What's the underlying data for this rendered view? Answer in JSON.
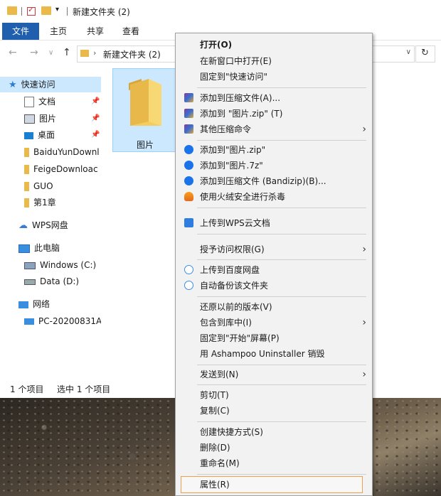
{
  "window": {
    "title": "新建文件夹 (2)"
  },
  "ribbon": {
    "tabs": [
      "文件",
      "主页",
      "共享",
      "查看"
    ]
  },
  "address": {
    "path": "新建文件夹 (2)"
  },
  "nav": {
    "quick_access": "快速访问",
    "items": [
      {
        "label": "文档",
        "pinned": true
      },
      {
        "label": "图片",
        "pinned": true
      },
      {
        "label": "桌面",
        "pinned": true
      },
      {
        "label": "BaiduYunDownl"
      },
      {
        "label": "FeigeDownloac"
      },
      {
        "label": "GUO"
      },
      {
        "label": "第1章"
      }
    ],
    "wps": "WPS网盘",
    "this_pc": "此电脑",
    "drives": [
      "Windows (C:)",
      "Data (D:)"
    ],
    "network": "网络",
    "network_pc": "PC-20200831AI"
  },
  "content": {
    "folder_name": "图片"
  },
  "status": {
    "count": "1 个项目",
    "selected": "选中 1 个项目"
  },
  "menu": {
    "items": [
      {
        "label": "打开(O)",
        "bold": true
      },
      {
        "label": "在新窗口中打开(E)"
      },
      {
        "label": "固定到\"快速访问\""
      },
      {
        "label": "添加到压缩文件(A)...",
        "icon": "winrar-icon"
      },
      {
        "label": "添加到 \"图片.zip\" (T)",
        "icon": "winrar-icon"
      },
      {
        "label": "其他压缩命令",
        "icon": "winrar-icon",
        "submenu": true
      },
      {
        "label": "添加到\"图片.zip\"",
        "icon": "bandizip-icon"
      },
      {
        "label": "添加到\"图片.7z\"",
        "icon": "bandizip-icon"
      },
      {
        "label": "添加到压缩文件 (Bandizip)(B)...",
        "icon": "bandizip-icon"
      },
      {
        "label": "使用火绒安全进行杀毒",
        "icon": "huorong-icon"
      },
      {
        "label": "上传到WPS云文档",
        "icon": "wps-cloud-icon"
      },
      {
        "label": "授予访问权限(G)",
        "submenu": true
      },
      {
        "label": "上传到百度网盘",
        "icon": "baidu-netdisk-icon"
      },
      {
        "label": "自动备份该文件夹",
        "icon": "baidu-netdisk-icon"
      },
      {
        "label": "还原以前的版本(V)"
      },
      {
        "label": "包含到库中(I)",
        "submenu": true
      },
      {
        "label": "固定到\"开始\"屏幕(P)"
      },
      {
        "label": "用 Ashampoo Uninstaller 销毁"
      },
      {
        "label": "发送到(N)",
        "submenu": true
      },
      {
        "label": "剪切(T)"
      },
      {
        "label": "复制(C)"
      },
      {
        "label": "创建快捷方式(S)"
      },
      {
        "label": "删除(D)"
      },
      {
        "label": "重命名(M)"
      },
      {
        "label": "属性(R)",
        "highlighted": true
      }
    ]
  },
  "colors": {
    "accent": "#1f5fae",
    "selection": "#cce8ff",
    "highlight_border": "#f0a04a",
    "folder": "#e9b949"
  }
}
